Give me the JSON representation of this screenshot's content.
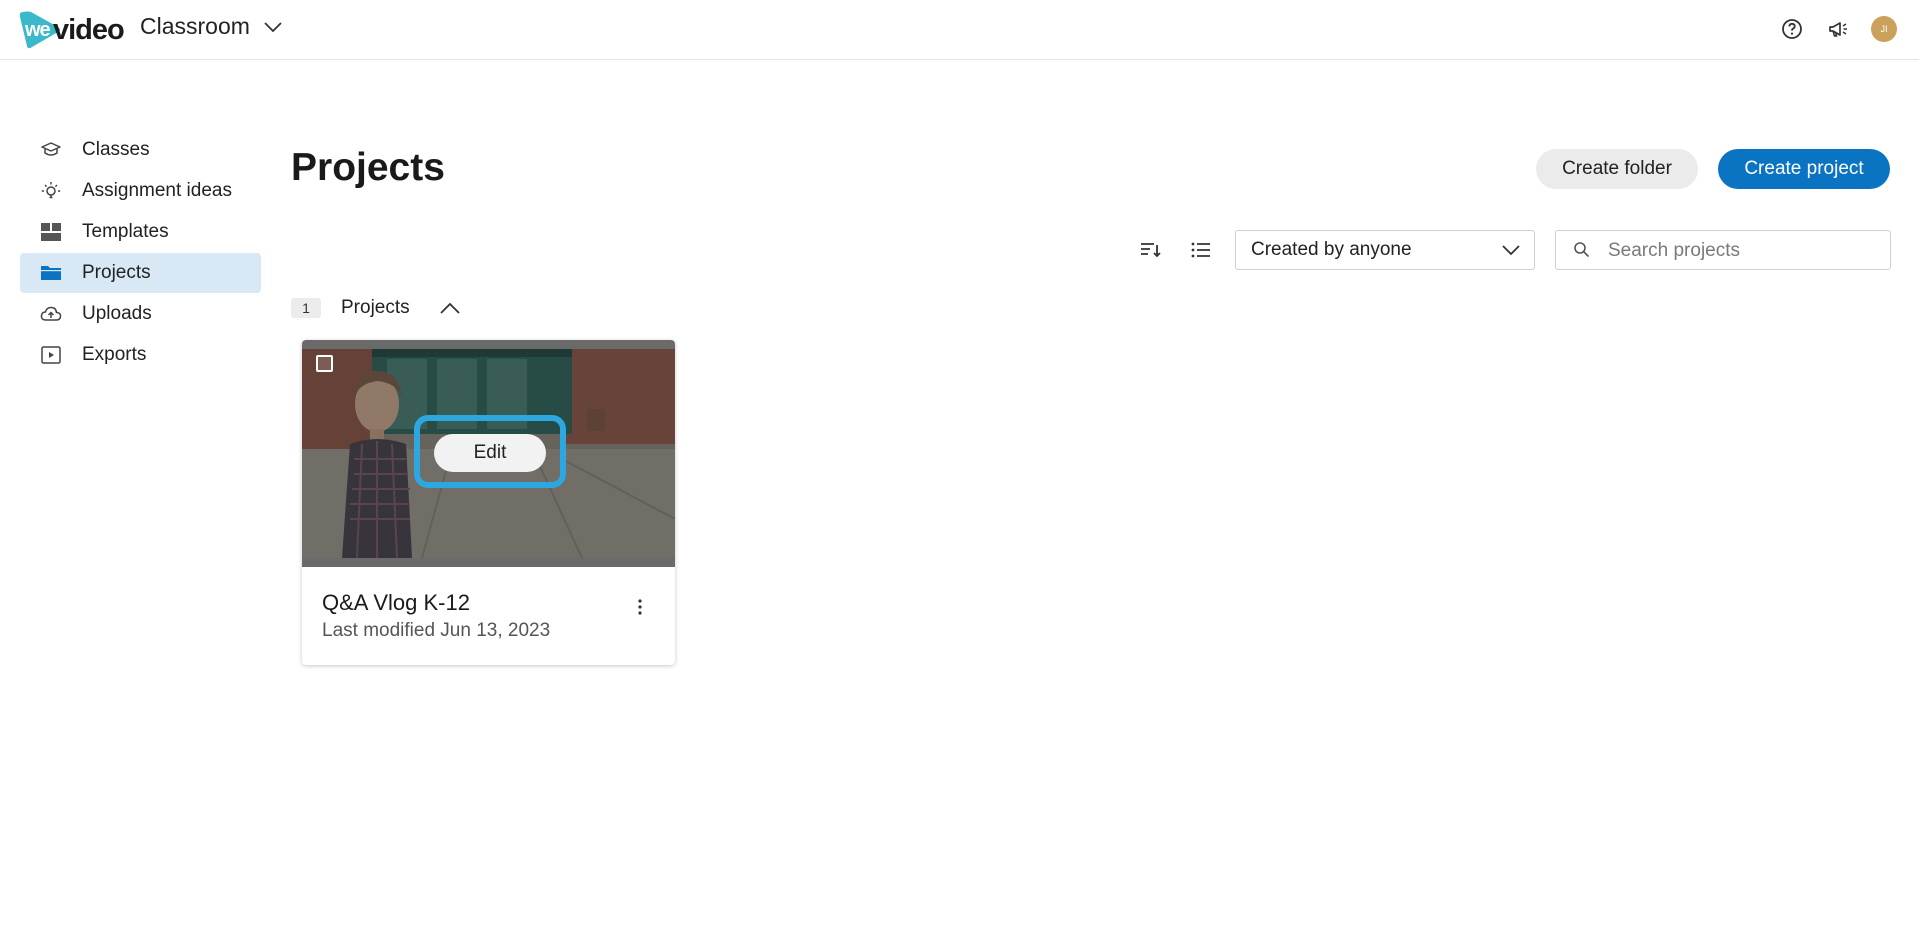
{
  "header": {
    "logo_text": "wevideo",
    "workspace": "Classroom",
    "icons": [
      "help-icon",
      "announcement-icon",
      "avatar"
    ],
    "avatar_initials": "JI",
    "brand_color": "#3bb8c9"
  },
  "sidebar": {
    "items": [
      {
        "label": "Classes",
        "icon": "graduation-cap-icon",
        "active": false
      },
      {
        "label": "Assignment ideas",
        "icon": "lightbulb-icon",
        "active": false
      },
      {
        "label": "Templates",
        "icon": "templates-icon",
        "active": false
      },
      {
        "label": "Projects",
        "icon": "folder-icon",
        "active": true
      },
      {
        "label": "Uploads",
        "icon": "cloud-upload-icon",
        "active": false
      },
      {
        "label": "Exports",
        "icon": "play-export-icon",
        "active": false
      }
    ],
    "active_color": "#d8e9f5"
  },
  "main": {
    "title": "Projects",
    "create_folder_label": "Create folder",
    "create_project_label": "Create project",
    "primary_color": "#0a74c2",
    "filter": {
      "selected": "Created by anyone"
    },
    "search": {
      "placeholder": "Search projects",
      "value": ""
    },
    "group": {
      "count": "1",
      "label": "Projects"
    },
    "projects": [
      {
        "title": "Q&A Vlog K-12",
        "modified": "Last modified Jun 13, 2023",
        "edit_label": "Edit",
        "highlight_color": "#2da7e0"
      }
    ]
  }
}
